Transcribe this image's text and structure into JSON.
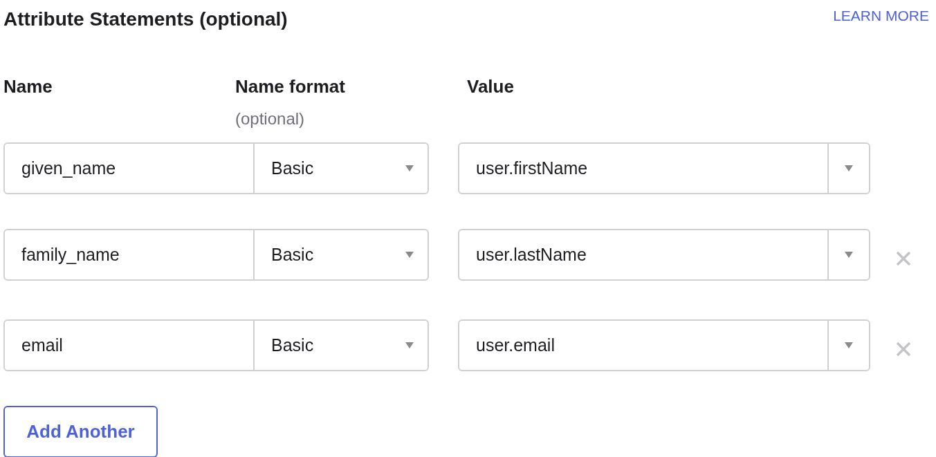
{
  "title": "Attribute Statements (optional)",
  "learn_more": "LEARN MORE",
  "columns": [
    {
      "label": "Name"
    },
    {
      "label": "Name format",
      "hint": "(optional)"
    },
    {
      "label": "Value"
    }
  ],
  "rows": [
    {
      "name": "given_name",
      "format": "Basic",
      "value": "user.firstName",
      "removable": false
    },
    {
      "name": "family_name",
      "format": "Basic",
      "value": "user.lastName",
      "removable": true
    },
    {
      "name": "email",
      "format": "Basic",
      "value": "user.email",
      "removable": true
    }
  ],
  "add_button": "Add Another"
}
